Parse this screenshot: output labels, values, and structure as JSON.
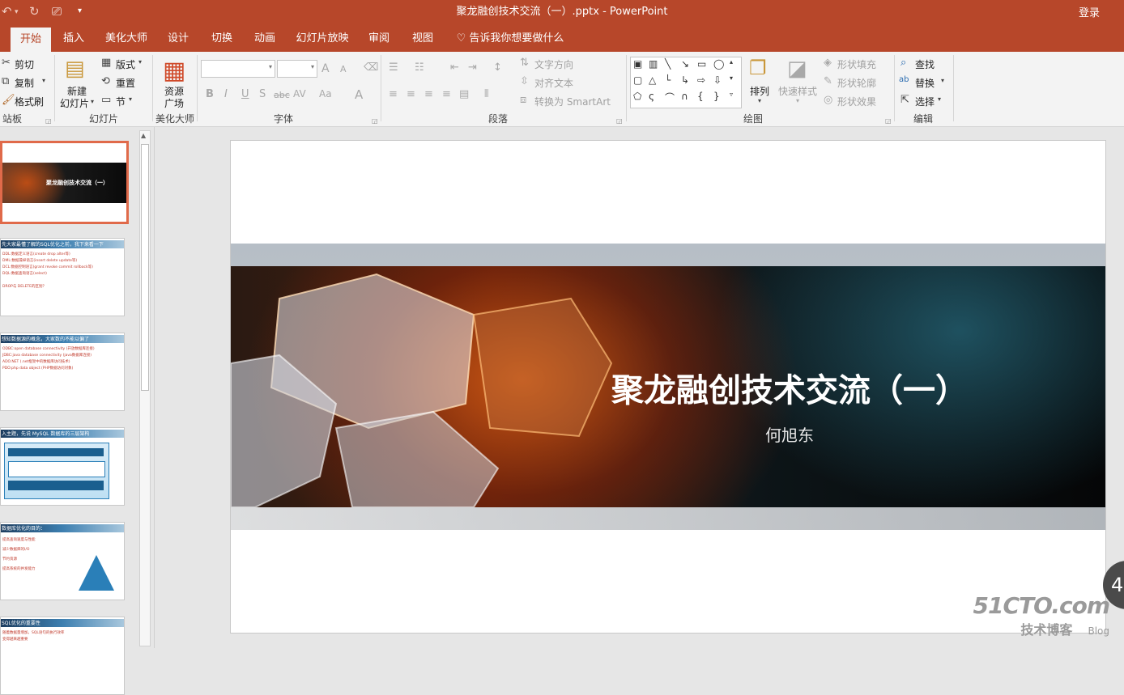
{
  "window": {
    "title": "聚龙融创技术交流（一）.pptx - PowerPoint",
    "login": "登录"
  },
  "tabs": [
    {
      "label": "开始",
      "active": true
    },
    {
      "label": "插入"
    },
    {
      "label": "美化大师"
    },
    {
      "label": "设计"
    },
    {
      "label": "切换"
    },
    {
      "label": "动画"
    },
    {
      "label": "幻灯片放映"
    },
    {
      "label": "审阅"
    },
    {
      "label": "视图"
    }
  ],
  "tellme": "告诉我你想要做什么",
  "ribbon": {
    "clipboard": {
      "cut": "剪切",
      "copy": "复制",
      "painter": "格式刷",
      "label": "站板"
    },
    "slides": {
      "new_line1": "新建",
      "new_line2": "幻灯片",
      "layout": "版式",
      "reset": "重置",
      "section": "节",
      "label": "幻灯片"
    },
    "beautify": {
      "line1": "资源",
      "line2": "广场",
      "label": "美化大师"
    },
    "font": {
      "label": "字体",
      "bold": "B",
      "italic": "I",
      "underline": "U",
      "shadow": "S",
      "strike": "abc",
      "spacing": "AV",
      "case": "Aa",
      "color": "A",
      "grow": "A",
      "shrink": "A"
    },
    "paragraph": {
      "text_direction": "文字方向",
      "align_text": "对齐文本",
      "smartart": "转换为 SmartArt",
      "label": "段落"
    },
    "drawing": {
      "arrange": "排列",
      "quick_styles": "快速样式",
      "fill": "形状填充",
      "outline": "形状轮廓",
      "effects": "形状效果",
      "label": "绘图"
    },
    "editing": {
      "find": "查找",
      "replace": "替换",
      "select": "选择",
      "label": "编辑"
    }
  },
  "thumbnails": [
    {
      "title": "聚龙融创技术交流（一）",
      "lines": []
    },
    {
      "title": "先大家最懂了解的SQL优化之前，我下来看一下",
      "lines": [
        "DDL:数据定义语言(create drop alter等)",
        "DML:数据操纵语言(insert delete update等)",
        "DCL:数据控制语言(grant revoke commit rollback等)",
        "DQL:数据查询语言(select)",
        "DROP与 DELETE的区别？"
      ]
    },
    {
      "title": "想知数据源的概念，大家数的不能以偏了",
      "lines": [
        "ODBC:open database connectivity (开放数据库连接)",
        "JDBC:java database connectivity (java数据库连接)",
        "ADO.NET (.net框架中的数据库访问技术)",
        "PDO:php data object (PHP数据访问对象)"
      ]
    },
    {
      "title": "入主题，先说 MySQL 数据库的三层架构",
      "lines": []
    },
    {
      "title": "数据库优化的目的：",
      "lines": [
        "提高查询速度与性能",
        "减少数据库的I/O",
        "节约资源",
        "提高系统的并发能力"
      ]
    },
    {
      "title": "SQL优化的重要性",
      "lines": [
        "随着数据量增加，SQL语句的执行效率",
        "变得越来越重要"
      ]
    }
  ],
  "slide": {
    "title": "聚龙融创技术交流（一）",
    "subtitle": "何旭东"
  },
  "watermark": {
    "brand": "51CTO.com",
    "sub": "技术博客",
    "blog": "Blog"
  },
  "badge": "4"
}
